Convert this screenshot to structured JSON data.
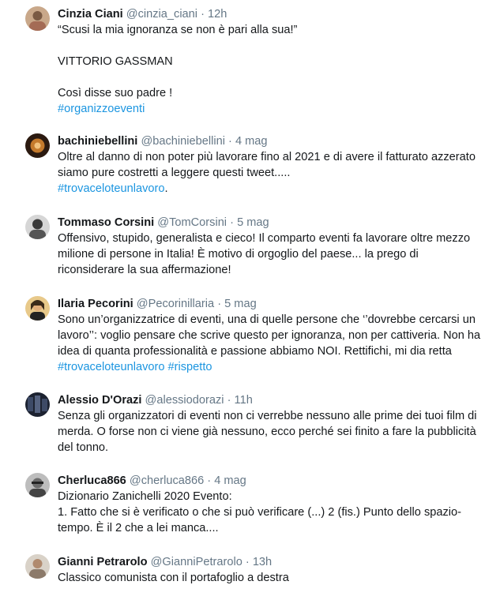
{
  "tweets": [
    {
      "name": "Cinzia Ciani",
      "handle": "@cinzia_ciani",
      "sep": "·",
      "time": "12h",
      "lines": [
        "“Scusi la mia ignoranza se non è pari alla sua!”",
        "",
        "VITTORIO GASSMAN",
        "",
        "Così disse suo padre !"
      ],
      "hashtags": [
        "#organizzoeventi"
      ]
    },
    {
      "name": "bachiniebellini",
      "handle": "@bachiniebellini",
      "sep": "·",
      "time": "4 mag",
      "text_a": "Oltre al danno di non poter più  lavorare fino al 2021 e di avere il fatturato azzerato  siamo pure costretti a leggere questi tweet.....",
      "hashtag": "#trovaceloteunlavoro",
      "suffix": "."
    },
    {
      "name": "Tommaso Corsini",
      "handle": "@TomCorsini",
      "sep": "·",
      "time": "5 mag",
      "text": "Offensivo, stupido, generalista e cieco! Il comparto eventi fa lavorare oltre mezzo milione di persone in Italia! È motivo di orgoglio del paese... la prego di riconsiderare la sua affermazione!"
    },
    {
      "name": "Ilaria Pecorini",
      "handle": "@Pecorinillaria",
      "sep": "·",
      "time": "5 mag",
      "text": "Sono un’organizzatrice di eventi, una di quelle persone che ‘’dovrebbe cercarsi un lavoro’’: voglio pensare che scrive questo per ignoranza, non per cattiveria. Non ha idea di quanta professionalità e passione abbiamo NOI. Rettifichi, mi dia retta ",
      "hashtag1": "#trovaceloteunlavoro",
      "hashtag2": "#rispetto"
    },
    {
      "name": "Alessio D'Orazi",
      "handle": "@alessiodorazi",
      "sep": "·",
      "time": "11h",
      "text": "Senza gli organizzatori di eventi non ci verrebbe nessuno alle prime dei tuoi film di merda. O forse non ci viene già nessuno, ecco perché sei finito a fare la pubblicità del tonno."
    },
    {
      "name": "Cherluca866",
      "handle": "@cherluca866",
      "sep": "·",
      "time": "4 mag",
      "line1": "Dizionario Zanichelli 2020 Evento:",
      "line2": "1. Fatto che si è verificato o che si può verificare (...) 2 (fis.) Punto dello spazio-tempo. È il 2 che a lei manca...."
    },
    {
      "name": "Gianni Petrarolo",
      "handle": "@GianniPetrarolo",
      "sep": "·",
      "time": "13h",
      "text": "Classico comunista con il portafoglio a destra"
    }
  ],
  "colors": {
    "name": "#14171a",
    "meta": "#657786",
    "hashtag": "#1b95e0"
  }
}
